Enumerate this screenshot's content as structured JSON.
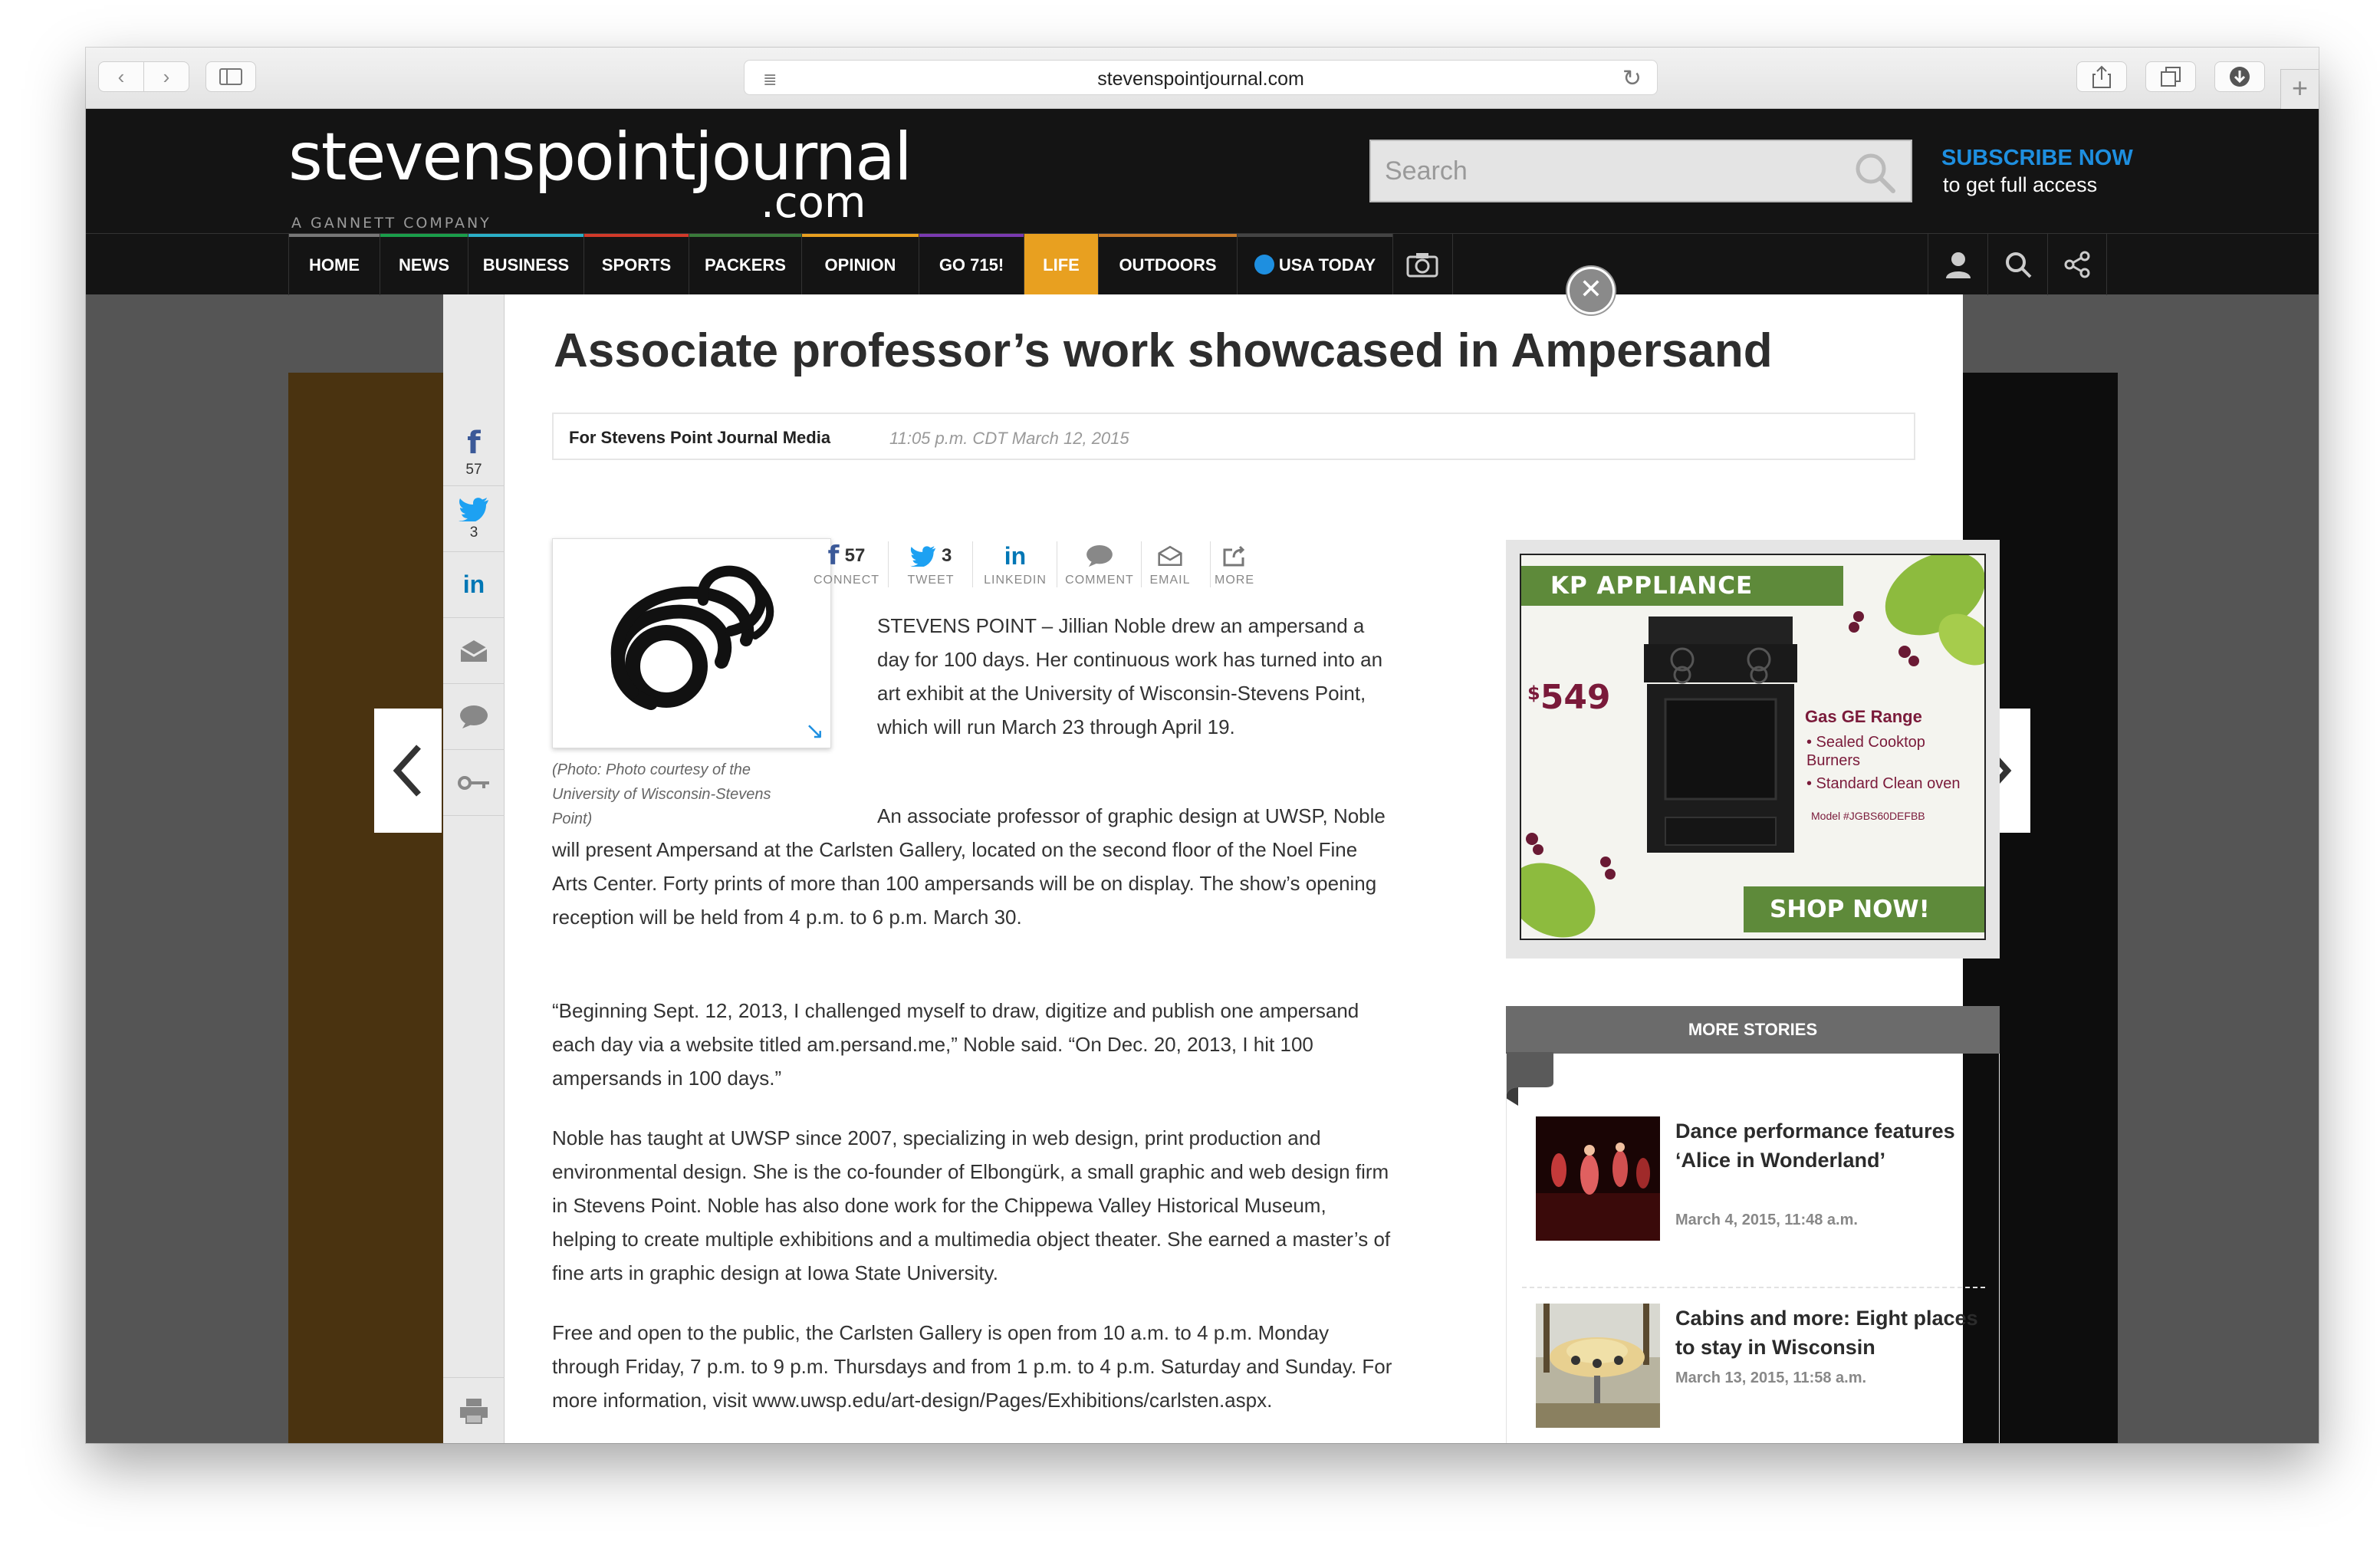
{
  "browser": {
    "url": "stevenspointjournal.com",
    "new_tab_label": "+"
  },
  "site": {
    "logo_main": "stevenspointjournal",
    "logo_com": ".com",
    "logo_sub": "A GANNETT COMPANY",
    "search_placeholder": "Search",
    "subscribe_title": "SUBSCRIBE NOW",
    "subscribe_sub": "to get full access"
  },
  "nav": {
    "items": [
      {
        "label": "HOME",
        "color": "#777777"
      },
      {
        "label": "NEWS",
        "color": "#1a9e4a"
      },
      {
        "label": "BUSINESS",
        "color": "#2bb0c8"
      },
      {
        "label": "SPORTS",
        "color": "#d23a2a"
      },
      {
        "label": "PACKERS",
        "color": "#3a7a3a"
      },
      {
        "label": "OPINION",
        "color": "#e8a020"
      },
      {
        "label": "GO 715!",
        "color": "#7a3ab0"
      },
      {
        "label": "LIFE",
        "color": "#e8a020"
      },
      {
        "label": "OUTDOORS",
        "color": "#c87a2a"
      },
      {
        "label": "USA TODAY",
        "color": "#444444"
      }
    ],
    "active": "LIFE"
  },
  "share_rail": {
    "facebook_count": "57",
    "twitter_count": "3"
  },
  "article": {
    "headline": "Associate professor’s work showcased in Ampersand",
    "author": "For Stevens Point Journal Media",
    "date": "11:05 p.m. CDT March 12, 2015",
    "photo_caption": "(Photo: Photo courtesy of the University of Wisconsin-Stevens Point)",
    "share_tools": [
      {
        "count": "57",
        "label": "CONNECT"
      },
      {
        "count": "3",
        "label": "TWEET"
      },
      {
        "count": "",
        "label": "LINKEDIN"
      },
      {
        "count": "",
        "label": "COMMENT"
      },
      {
        "count": "",
        "label": "EMAIL"
      },
      {
        "count": "",
        "label": "MORE"
      }
    ],
    "paragraphs": [
      "STEVENS POINT – Jillian Noble drew an ampersand a day for 100 days. Her continuous work has turned into an art exhibit at the University of Wisconsin-Stevens Point, which will run March 23 through April 19.",
      "An associate professor of graphic design at UWSP, Noble will present Ampersand at the Carlsten Gallery, located on the second floor of the Noel Fine Arts Center. Forty prints of more than 100 ampersands will be on display. The show’s opening reception will be held from 4 p.m. to 6 p.m. March 30.",
      "“Beginning Sept. 12, 2013, I challenged myself to draw, digitize and publish one ampersand each day via a website titled am.persand.me,” Noble said. “On Dec. 20, 2013, I hit 100 ampersands in 100 days.”",
      "Noble has taught at UWSP since 2007, specializing in web design, print production and environmental design. She is the co-founder of Elbongürk, a small graphic and web design firm in Stevens Point. Noble has also done work for the Chippewa Valley Historical Museum, helping to create multiple exhibitions and a multimedia object theater. She earned a master’s of fine arts in graphic design at Iowa State University.",
      "Free and open to the public, the Carlsten Gallery is open from 10 a.m. to 4 p.m. Monday through Friday, 7 p.m. to 9 p.m. Thursdays and from 1 p.m. to 4 p.m. Saturday and Sunday. For more information, visit www.uwsp.edu/art-design/Pages/Exhibitions/carlsten.aspx."
    ]
  },
  "ad": {
    "brand": "KP APPLIANCE",
    "price_symbol": "$",
    "price": "549",
    "product": "Gas GE Range",
    "features": [
      "• Sealed Cooktop Burners",
      "• Standard Clean oven"
    ],
    "model": "Model #JGBS60DEFBB",
    "cta": "SHOP NOW!",
    "colors": {
      "green": "#5e8a3a",
      "maroon": "#7a1a3a"
    }
  },
  "more_stories": {
    "title": "MORE STORIES",
    "items": [
      {
        "title": "Dance performance features ‘Alice in Wonderland’",
        "date": "March 4, 2015, 11:48 a.m."
      },
      {
        "title": "Cabins and more: Eight places to stay in Wisconsin",
        "date": "March 13, 2015, 11:58 a.m."
      }
    ]
  }
}
